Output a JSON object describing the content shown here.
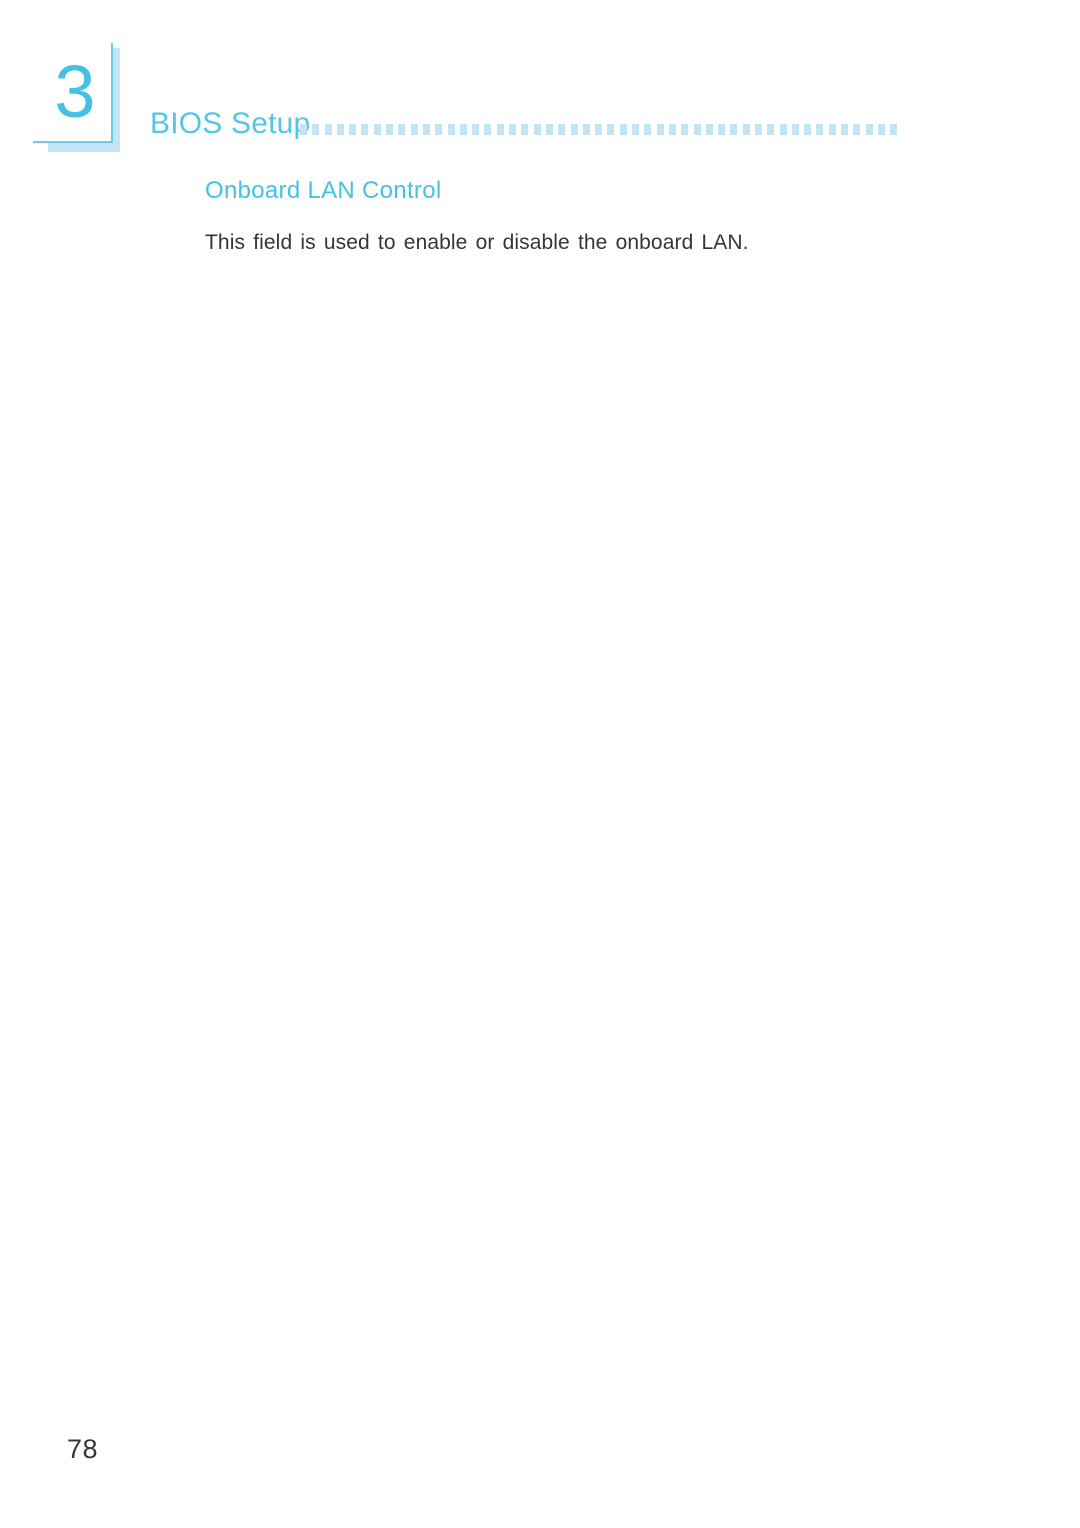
{
  "document": {
    "chapter_number": "3",
    "chapter_title": "BIOS Setup",
    "page_number": "78"
  },
  "header": {
    "rule_dash_count": 49,
    "dash_color": "#c2e4f4",
    "rule_color": "#6ecbe8",
    "accent_color": "#45c1e5"
  },
  "content": {
    "section_heading": "Onboard LAN Control",
    "paragraphs": [
      "This field is used to enable or disable the onboard LAN."
    ]
  },
  "colors": {
    "accent": "#45c1e5",
    "accent_light": "#c2e4f4",
    "accent_mid": "#6ecbe8",
    "text": "#3b3238",
    "background": "#ffffff"
  }
}
